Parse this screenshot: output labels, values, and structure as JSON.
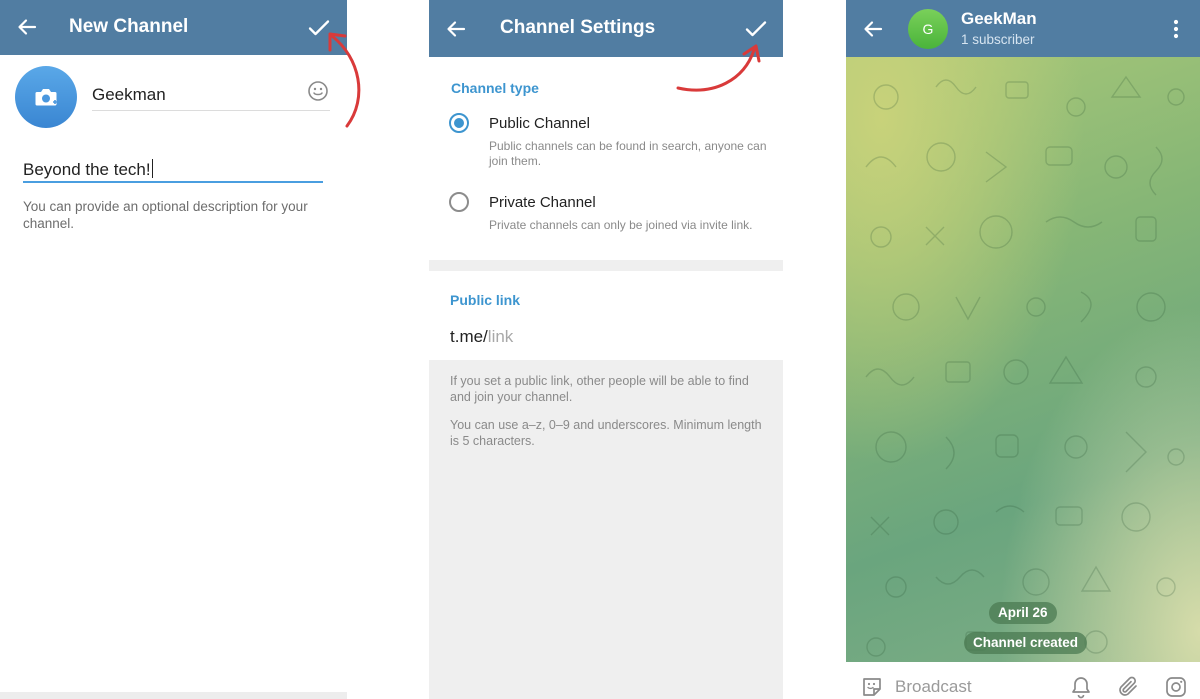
{
  "new_channel": {
    "title": "New Channel",
    "name_value": "Geekman",
    "description_value": "Beyond the tech!",
    "hint": "You can provide an optional description for your channel."
  },
  "channel_settings": {
    "title": "Channel Settings",
    "channel_type_header": "Channel type",
    "public_title": "Public Channel",
    "public_desc": "Public channels can be found in search, anyone can join them.",
    "private_title": "Private Channel",
    "private_desc": "Private channels can only be joined via invite link.",
    "selected": "Public Channel",
    "public_link_header": "Public link",
    "link_prefix": "t.me/",
    "link_placeholder": "link",
    "info_1": "If you set a public link, other people will be able to find and join your channel.",
    "info_2": "You can use a–z, 0–9 and underscores. Minimum length is 5 characters."
  },
  "chat": {
    "avatar_letter": "G",
    "channel_name": "GeekMan",
    "subscribers": "1 subscriber",
    "date_pill": "April 26",
    "service_msg": "Channel created",
    "input_placeholder": "Broadcast"
  },
  "colors": {
    "header": "#517da2",
    "accent": "#3d95cf",
    "annotation_arrow": "#d93a3a"
  },
  "icons": [
    "back-arrow-icon",
    "checkmark-icon",
    "camera-icon",
    "emoji-icon",
    "more-vertical-icon",
    "sticker-icon",
    "bell-icon",
    "paperclip-icon",
    "instagram-icon"
  ]
}
